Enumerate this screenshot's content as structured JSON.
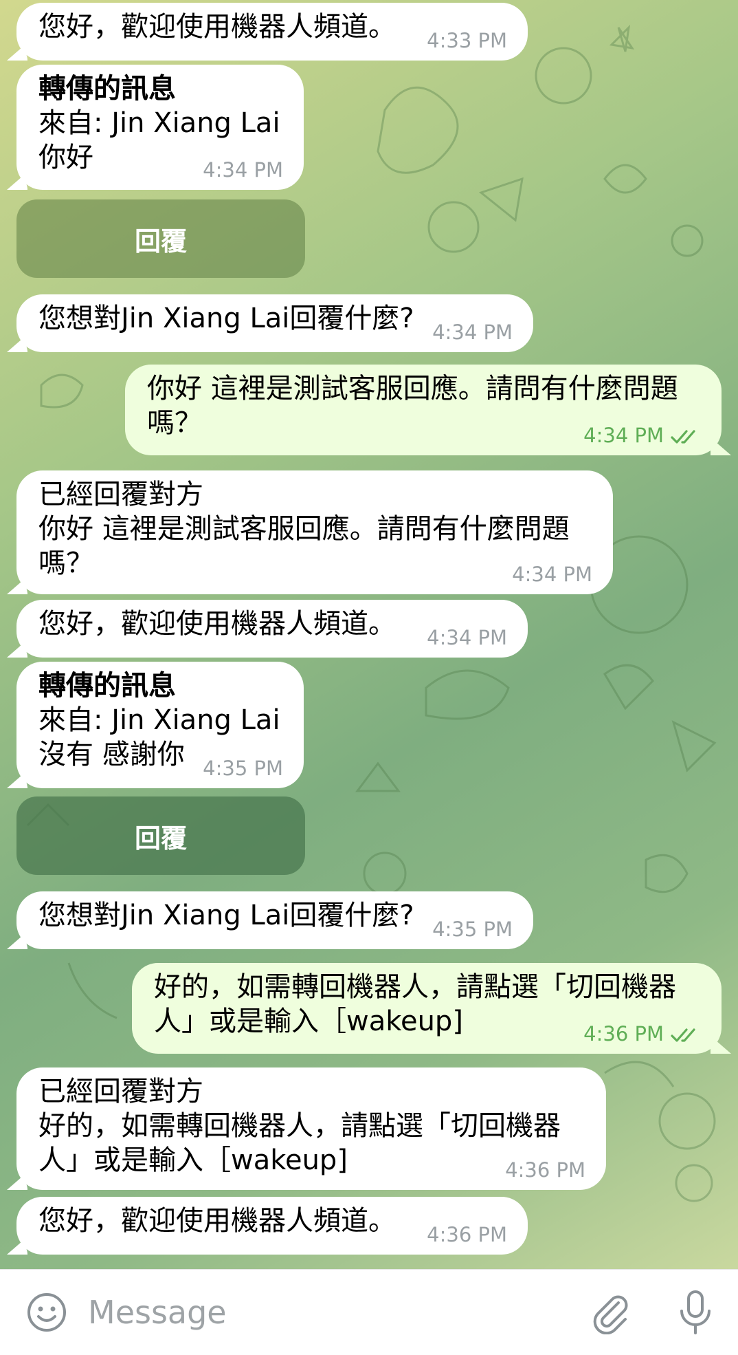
{
  "messages": [
    {
      "dir": "in",
      "lines": [
        "您好，歡迎使用機器人頻道。"
      ],
      "time": "4:33 PM"
    },
    {
      "dir": "in",
      "lines": [
        "轉傳的訊息",
        "來自: Jin Xiang Lai",
        "你好"
      ],
      "time": "4:34 PM"
    },
    {
      "dir": "in",
      "lines": [
        "您想對Jin Xiang Lai回覆什麼?"
      ],
      "time": "4:34 PM"
    },
    {
      "dir": "out",
      "lines": [
        "你好 這裡是測試客服回應。請問有什麼問題",
        "嗎？"
      ],
      "time": "4:34 PM"
    },
    {
      "dir": "in",
      "lines": [
        "已經回覆對方",
        "你好 這裡是測試客服回應。請問有什麼問題",
        "嗎？"
      ],
      "time": "4:34 PM"
    },
    {
      "dir": "in",
      "lines": [
        "您好，歡迎使用機器人頻道。"
      ],
      "time": "4:34 PM"
    },
    {
      "dir": "in",
      "lines": [
        "轉傳的訊息",
        "來自: Jin Xiang Lai",
        "沒有 感謝你"
      ],
      "time": "4:35 PM"
    },
    {
      "dir": "in",
      "lines": [
        "您想對Jin Xiang Lai回覆什麼?"
      ],
      "time": "4:35 PM"
    },
    {
      "dir": "out",
      "lines": [
        "好的，如需轉回機器人，請點選「切回機器",
        "人」或是輸入［wakeup]"
      ],
      "time": "4:36 PM"
    },
    {
      "dir": "in",
      "lines": [
        "已經回覆對方",
        "好的，如需轉回機器人，請點選「切回機器",
        "人」或是輸入［wakeup]"
      ],
      "time": "4:36 PM"
    },
    {
      "dir": "in",
      "lines": [
        "您好，歡迎使用機器人頻道。"
      ],
      "time": "4:36 PM"
    }
  ],
  "reply_buttons": [
    {
      "label": "回覆"
    },
    {
      "label": "回覆"
    }
  ],
  "input": {
    "placeholder": "Message",
    "emoji_icon": "emoji-icon",
    "attach_icon": "paperclip-icon",
    "mic_icon": "microphone-icon"
  },
  "colors": {
    "incoming_bubble": "#ffffff",
    "outgoing_bubble": "#effedd",
    "outgoing_time": "#5fae56",
    "reply_button": "#6b8a4f"
  }
}
